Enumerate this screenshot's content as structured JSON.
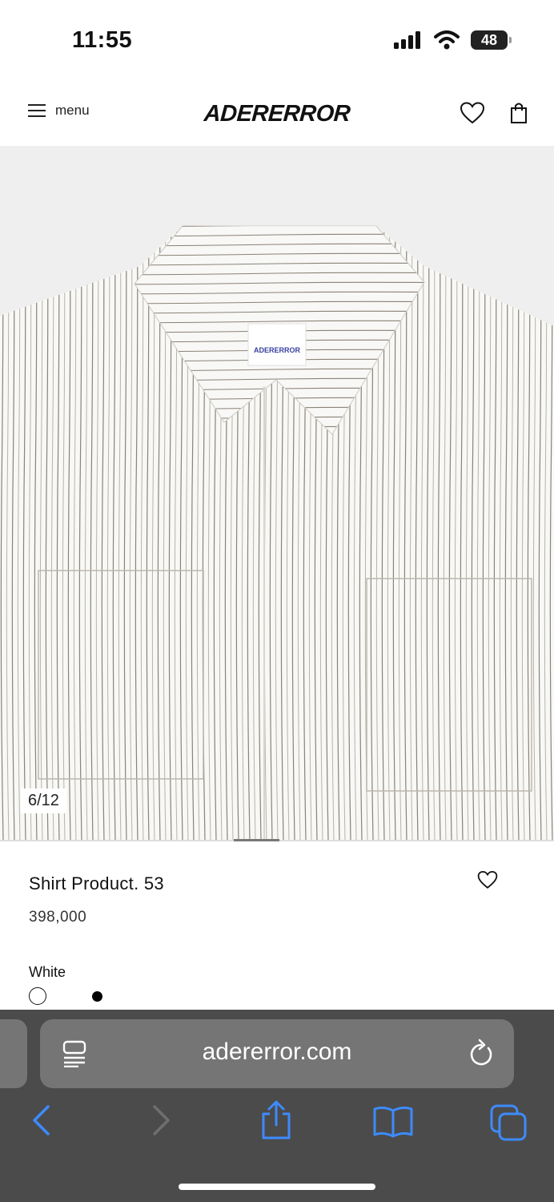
{
  "status_bar": {
    "time": "11:55",
    "battery": "48"
  },
  "header": {
    "menu_label": "menu",
    "logo": "ADERERROR"
  },
  "gallery": {
    "counter": "6/12",
    "label_text": "ADERERROR",
    "progress_fraction": 0.5
  },
  "product": {
    "name": "Shirt Product. 53",
    "price": "398,000",
    "color_label": "White",
    "colors": [
      "white",
      "black"
    ]
  },
  "browser": {
    "url": "adererror.com"
  },
  "icons": [
    "menu-icon",
    "heart-icon",
    "bag-icon",
    "reader-icon",
    "reload-icon",
    "back-icon",
    "forward-icon",
    "share-icon",
    "bookmarks-icon",
    "tabs-icon"
  ],
  "colors": {
    "toolbar_bg": "#4b4b4b",
    "url_bar_bg": "#757575",
    "accent": "#3d8bfd"
  }
}
